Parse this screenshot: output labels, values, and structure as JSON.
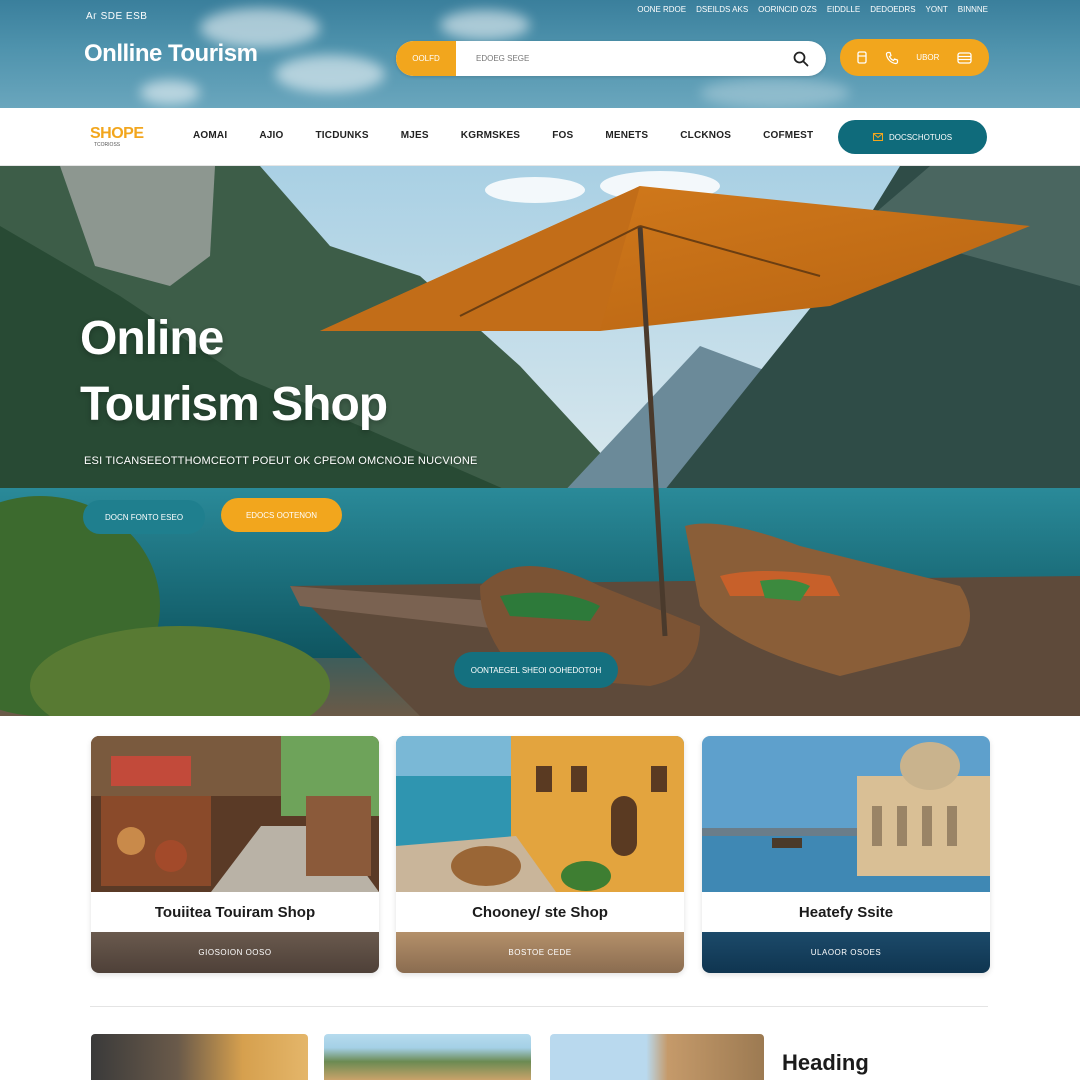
{
  "topbar": {
    "small_text": "Аг  SDE  ESB",
    "links": [
      "OONE RDOE",
      "DSEILDS AKS",
      "OORINCID OZS",
      "EIDDLLE",
      "DEDOEDRS",
      "YONT",
      "BINNNE"
    ]
  },
  "header": {
    "brand": "Onlline Tourism",
    "search": {
      "category_label": "OOLFD",
      "placeholder": "EDOEG SEGE"
    },
    "quick_actions": {
      "label": "UBOR"
    }
  },
  "logo": {
    "text": "SHOPE",
    "subtitle": "TCORIOSS"
  },
  "nav": {
    "items": [
      "AOMAI",
      "AJIO",
      "TICDUNKS",
      "MJES",
      "KGRMSKES",
      "FOS",
      "MENETS",
      "CLCKNOS",
      "COFMEST"
    ],
    "cta_label": "DOCSCHOTUOS"
  },
  "hero": {
    "title_line1": "Online",
    "title_line2": "Tourism Shop",
    "subtitle": "ESI TICANSEEOTTHOMCEOTT POEUT OK CPEOM OMCNOJE NUCVIONE",
    "btn_teal": "DOCN FONTO ESEO",
    "btn_orange": "EDOCS OOTENON",
    "btn_center": "OONTAEGEL SHEOI OOHEDOTOH"
  },
  "cards": [
    {
      "title": "Touiitea Touiram Shop",
      "footer": "GIOSOION OOSO"
    },
    {
      "title": "Chooney/ ste Shop",
      "footer": "BOSTOE CEDE"
    },
    {
      "title": "Heatefy Ssite",
      "footer": "ULAOOR OSOES"
    }
  ],
  "bottom": {
    "heading": "Heading"
  },
  "colors": {
    "accent_orange": "#f2a61d",
    "accent_teal": "#0f6b7b",
    "text_dark": "#1b1b1b"
  },
  "icons": [
    "search-icon",
    "phone-icon",
    "cart-icon",
    "wallet-icon",
    "mail-icon"
  ]
}
